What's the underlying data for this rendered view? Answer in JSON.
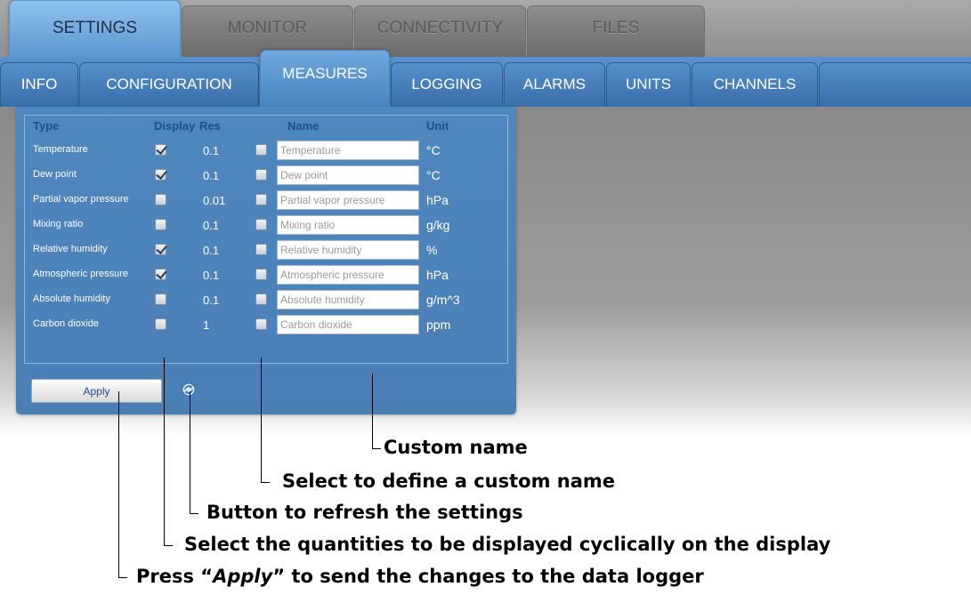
{
  "top_tabs": [
    {
      "label": "SETTINGS",
      "active": true
    },
    {
      "label": "MONITOR",
      "active": false
    },
    {
      "label": "CONNECTIVITY",
      "active": false
    },
    {
      "label": "FILES",
      "active": false
    }
  ],
  "sub_tabs": [
    {
      "label": "INFO",
      "active": false
    },
    {
      "label": "CONFIGURATION",
      "active": false
    },
    {
      "label": "MEASURES",
      "active": true
    },
    {
      "label": "LOGGING",
      "active": false
    },
    {
      "label": "ALARMS",
      "active": false
    },
    {
      "label": "UNITS",
      "active": false
    },
    {
      "label": "CHANNELS",
      "active": false
    }
  ],
  "measures": {
    "headers": {
      "type": "Type",
      "display": "Display",
      "res": "Res",
      "name": "Name",
      "unit": "Unit"
    },
    "rows": [
      {
        "type": "Temperature",
        "display": true,
        "res": "0.1",
        "custom": false,
        "name": "Temperature",
        "unit": "°C"
      },
      {
        "type": "Dew point",
        "display": true,
        "res": "0.1",
        "custom": false,
        "name": "Dew point",
        "unit": "°C"
      },
      {
        "type": "Partial vapor pressure",
        "display": false,
        "res": "0.01",
        "custom": false,
        "name": "Partial vapor pressure",
        "unit": "hPa"
      },
      {
        "type": "Mixing ratio",
        "display": false,
        "res": "0.1",
        "custom": false,
        "name": "Mixing ratio",
        "unit": "g/kg"
      },
      {
        "type": "Relative humidity",
        "display": true,
        "res": "0.1",
        "custom": false,
        "name": "Relative humidity",
        "unit": "%"
      },
      {
        "type": "Atmospheric pressure",
        "display": true,
        "res": "0.1",
        "custom": false,
        "name": "Atmospheric pressure",
        "unit": "hPa"
      },
      {
        "type": "Absolute humidity",
        "display": false,
        "res": "0.1",
        "custom": false,
        "name": "Absolute humidity",
        "unit": "g/m^3"
      },
      {
        "type": "Carbon dioxide",
        "display": false,
        "res": "1",
        "custom": false,
        "name": "Carbon dioxide",
        "unit": "ppm"
      }
    ],
    "apply_label": "Apply",
    "refresh_icon": "refresh-icon"
  },
  "annotations": {
    "custom_name": "Custom name",
    "select_custom": "Select to define a custom name",
    "refresh_button": "Button to refresh the settings",
    "select_display": "Select the quantities to be displayed cyclically on the display",
    "apply_prefix": "Press “",
    "apply_word": "Apply",
    "apply_suffix": "” to send the changes to the data logger"
  },
  "colors": {
    "accent_blue": "#4a84c0",
    "header_text": "#1f4f8a",
    "inactive_tab": "#7c7c7c"
  }
}
